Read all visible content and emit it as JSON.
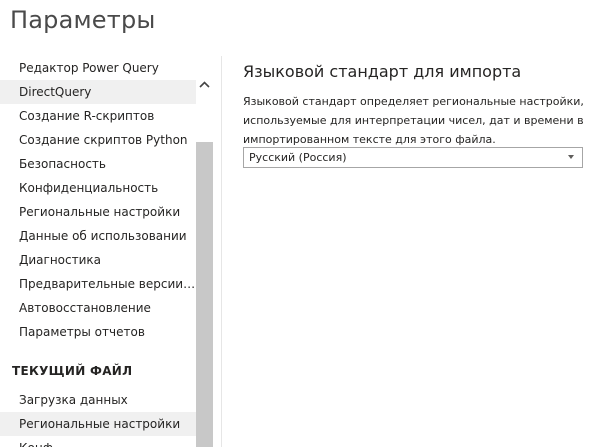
{
  "window": {
    "title": "Параметры"
  },
  "sidebar": {
    "items": [
      {
        "label": "Редактор Power Query"
      },
      {
        "label": "DirectQuery"
      },
      {
        "label": "Создание R-скриптов"
      },
      {
        "label": "Создание скриптов Python"
      },
      {
        "label": "Безопасность"
      },
      {
        "label": "Конфиденциальность"
      },
      {
        "label": "Региональные настройки"
      },
      {
        "label": "Данные об использовании"
      },
      {
        "label": "Диагностика"
      },
      {
        "label": "Предварительные версии во..."
      },
      {
        "label": "Автовосстановление"
      },
      {
        "label": "Параметры отчетов"
      }
    ],
    "current_file_header": "ТЕКУЩИЙ ФАЙЛ",
    "current_file_items": [
      {
        "label": "Загрузка данных"
      },
      {
        "label": "Региональные настройки"
      },
      {
        "label": "Конф..."
      }
    ]
  },
  "content": {
    "section_title": "Языковой стандарт для импорта",
    "description": "Языковой стандарт определяет региональные настройки, используемые для интерпретации чисел, дат и времени в импортированном тексте для этого файла.",
    "locale_select": {
      "value": "Русский (Россия)"
    }
  }
}
